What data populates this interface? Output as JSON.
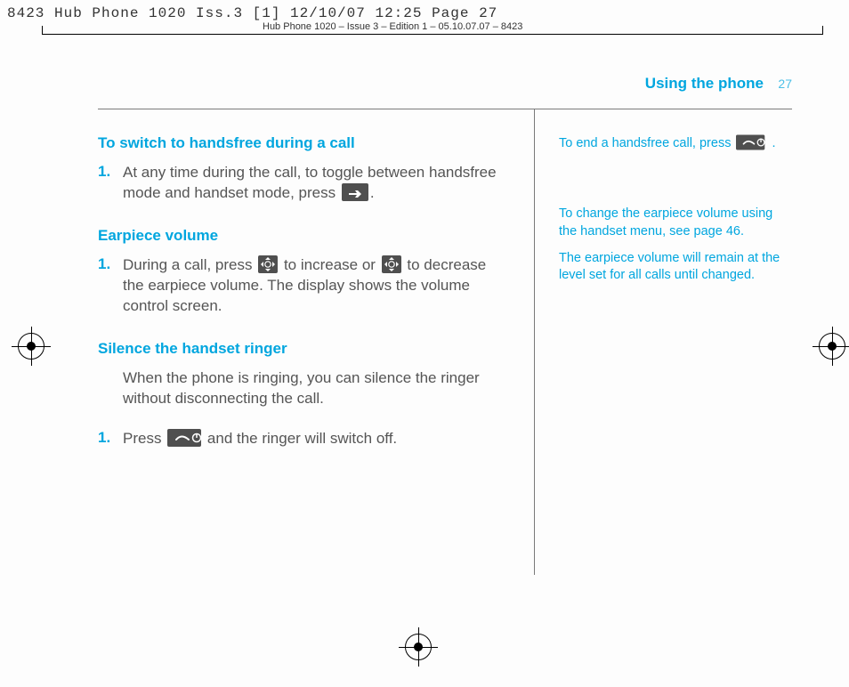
{
  "slug": "8423 Hub Phone 1020 Iss.3 [1]  12/10/07  12:25  Page 27",
  "slug_sub": "Hub Phone 1020 – Issue 3 – Edition 1 – 05.10.07.07 – 8423",
  "running_head": {
    "title": "Using the phone",
    "page_number": "27"
  },
  "sections": {
    "handsfree": {
      "heading": "To switch to handsfree during a call",
      "step1_num": "1.",
      "step1_a": "At any time during the call, to toggle between handsfree mode and handset mode, press ",
      "step1_b": "."
    },
    "earpiece": {
      "heading": "Earpiece volume",
      "step1_num": "1.",
      "step1_a": "During a call, press ",
      "step1_b": " to increase or ",
      "step1_c": " to decrease the earpiece volume. The display shows the volume control screen."
    },
    "silence": {
      "heading": "Silence the handset ringer",
      "intro": "When the phone is ringing, you can silence the ringer without disconnecting the call.",
      "step1_num": "1.",
      "step1_a": "Press ",
      "step1_b": " and the ringer will switch off."
    }
  },
  "sidenotes": {
    "end_call_a": "To end a handsfree call, press ",
    "end_call_b": ".",
    "volume_menu": "To change the earpiece volume using the handset menu, see page 46.",
    "volume_persist": "The earpiece volume will remain at the level set for all calls until changed."
  },
  "icons": {
    "redial_key": "redial-key",
    "nav_key": "navigation-key",
    "end_call_key": "end-call-power-key"
  }
}
